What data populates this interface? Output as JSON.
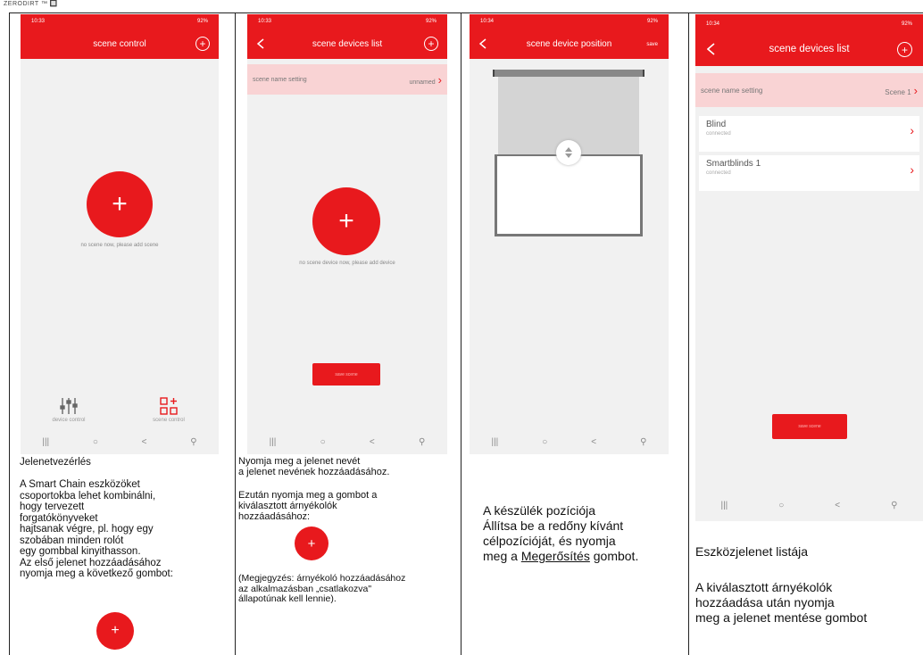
{
  "header_mark": "ZERODIRT ™ 🔲",
  "screen1": {
    "status": {
      "time": "10:33",
      "signal": "92%"
    },
    "title": "scene control",
    "empty_text": "no scene now, please add scene",
    "fab_plus": "+",
    "tool_device": "device control",
    "tool_scene": "scene control",
    "nav": [
      "|||",
      "○",
      "<",
      "⚲"
    ]
  },
  "screen2": {
    "status": {
      "time": "10:33",
      "signal": "92%"
    },
    "title": "scene devices list",
    "name_label": "scene name setting",
    "name_value": "unnamed",
    "empty_text": "no scene device now, please add device",
    "fab_plus": "+",
    "save_label": "save scene",
    "nav": [
      "|||",
      "○",
      "<",
      "⚲"
    ]
  },
  "screen3": {
    "status": {
      "time": "10:34",
      "signal": "92%"
    },
    "title": "scene device position",
    "save_link": "save",
    "nav": [
      "|||",
      "○",
      "<",
      "⚲"
    ]
  },
  "screen4": {
    "status": {
      "time": "10:34",
      "signal": "92%"
    },
    "title": "scene devices list",
    "name_label": "scene name setting",
    "name_value": "Scene 1",
    "devices": [
      {
        "name": "Blind",
        "status": "connected"
      },
      {
        "name": "Smartblinds 1",
        "status": "connected"
      }
    ],
    "save_label": "save scene",
    "nav": [
      "|||",
      "○",
      "<",
      "⚲"
    ]
  },
  "captions": {
    "c1": "Jelenetvezérlés\n\nA Smart Chain eszközöket\ncsoportokba lehet kombinálni,\nhogy tervezett\nforgatókönyveket\nhajtsanak végre, pl. hogy egy\nszobában minden rolót\negy gombbal kinyithasson.\nAz első jelenet hozzáadásához\nnyomja meg a következő gombot:",
    "c2a": "Nyomja meg a jelenet nevét\na jelenet nevének hozzáadásához.",
    "c2b": "Ezután nyomja meg a gombot a\nkiválasztott árnyékolók\nhozzáadásához:",
    "c2c": "(Megjegyzés: árnyékoló hozzáadásához\naz alkalmazásban „csatlakozva\"\nállapotúnak kell lennie).",
    "c3_line1": "A készülék pozíciója",
    "c3_line2": "Állítsa be a redőny kívánt",
    "c3_line3": "célpozícióját, és nyomja",
    "c3_pre": "meg a ",
    "c3_link": "Megerősítés",
    "c3_post": " gombot.",
    "c4a": "Eszközjelenet  listája",
    "c4b": "A kiválasztott árnyékolók\n hozzáadása után nyomja\nmeg a jelenet mentése gombot"
  },
  "colors": {
    "accent": "#e8191d",
    "name_row": "#f9d3d4"
  }
}
